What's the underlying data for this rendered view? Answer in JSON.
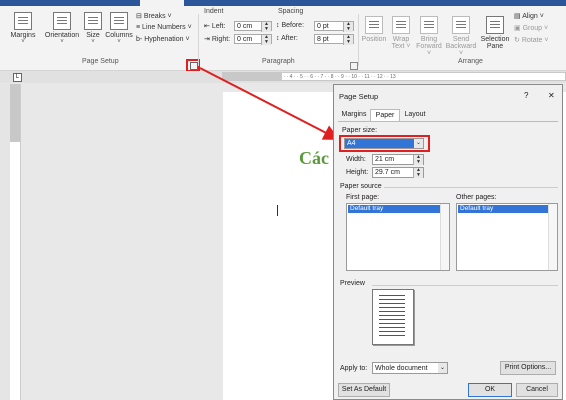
{
  "ribbon": {
    "buttons": [
      {
        "label": "Margins",
        "arrow": "˅"
      },
      {
        "label": "Orientation",
        "arrow": "˅"
      },
      {
        "label": "Size",
        "arrow": "˅"
      },
      {
        "label": "Columns",
        "arrow": "˅"
      }
    ],
    "breaks": "Breaks ˅",
    "line_numbers": "Line Numbers ˅",
    "hyphenation": "Hyphenation ˅",
    "page_setup_group": "Page Setup",
    "indent_title": "Indent",
    "indent_left_label": "Left:",
    "indent_left_value": "0 cm",
    "indent_right_label": "Right:",
    "indent_right_value": "0 cm",
    "spacing_title": "Spacing",
    "spacing_before_label": "Before:",
    "spacing_before_value": "0 pt",
    "spacing_after_label": "After:",
    "spacing_after_value": "8 pt",
    "paragraph_group": "Paragraph",
    "position": "Position",
    "wrap_text": [
      "Wrap",
      "Text ˅"
    ],
    "bring_forward": [
      "Bring",
      "Forward ˅"
    ],
    "send_backward": [
      "Send",
      "Backward ˅"
    ],
    "selection_pane": [
      "Selection",
      "Pane"
    ],
    "align": "Align ˅",
    "group": "Group ˅",
    "rotate": "Rotate ˅",
    "arrange_group": "Arrange"
  },
  "ruler": {
    "text": "· 2 · · 1 · · · · · · 1 · · 2 · · 3 · · 4 · · 5 · · 6 · · 7 · · 8 · · 9 · · 10 · · 11 · · 12 · · 13"
  },
  "document": {
    "visible_text": "Các"
  },
  "dialog": {
    "title": "Page Setup",
    "help": "?",
    "close": "✕",
    "tabs": [
      "Margins",
      "Paper",
      "Layout"
    ],
    "active_tab": "Paper",
    "paper_size_label": "Paper size:",
    "paper_size_value": "A4",
    "width_label": "Width:",
    "width_value": "21 cm",
    "height_label": "Height:",
    "height_value": "29.7 cm",
    "paper_source_label": "Paper source",
    "first_page_label": "First page:",
    "first_page_item": "Default tray",
    "other_pages_label": "Other pages:",
    "other_pages_item": "Default tray",
    "preview_label": "Preview",
    "apply_to_label": "Apply to:",
    "apply_to_value": "Whole document",
    "print_options": "Print Options...",
    "set_as_default": "Set As Default",
    "ok": "OK",
    "cancel": "Cancel"
  },
  "colors": {
    "ribbon_accent": "#2b579a",
    "highlight_red": "#e02020",
    "selection_blue": "#3375d6",
    "document_text_green": "#5a9a3a"
  }
}
